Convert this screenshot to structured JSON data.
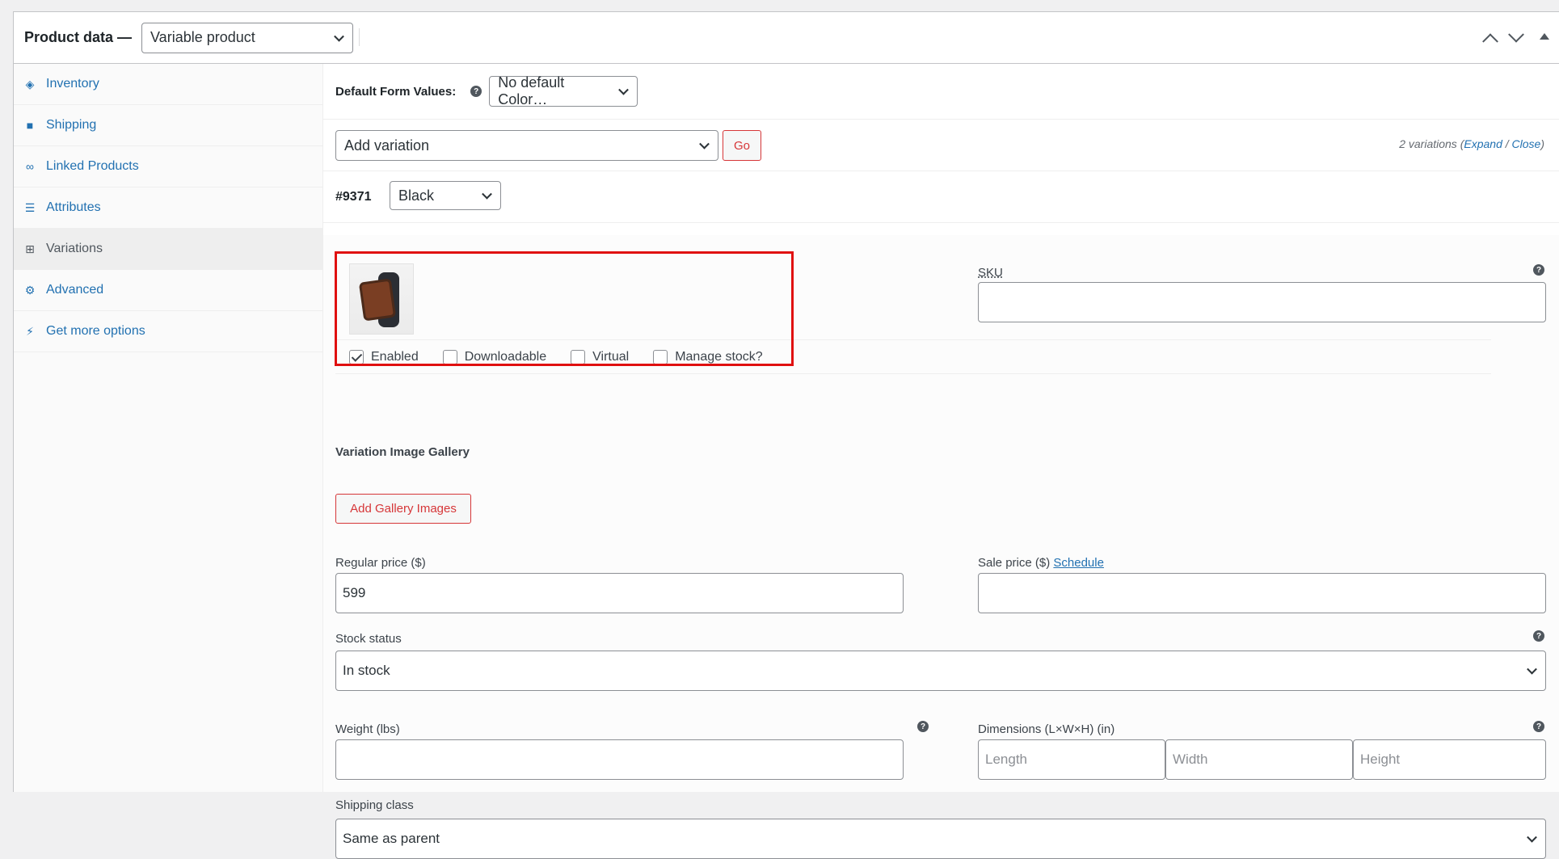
{
  "header": {
    "title": "Product data —",
    "product_type": "Variable product"
  },
  "sidebar": {
    "items": [
      {
        "label": "Inventory",
        "icon": "tag-icon"
      },
      {
        "label": "Shipping",
        "icon": "truck-icon"
      },
      {
        "label": "Linked Products",
        "icon": "link-icon"
      },
      {
        "label": "Attributes",
        "icon": "list-icon"
      },
      {
        "label": "Variations",
        "icon": "grid-icon"
      },
      {
        "label": "Advanced",
        "icon": "gear-icon"
      },
      {
        "label": "Get more options",
        "icon": "plugin-icon"
      }
    ]
  },
  "defaults": {
    "label": "Default Form Values:",
    "color_select": "No default Color…"
  },
  "variation_actions": {
    "select": "Add variation",
    "go": "Go",
    "count_text": "2 variations (",
    "expand": "Expand",
    "slash": " / ",
    "close": "Close",
    "close_paren": ")"
  },
  "variation": {
    "id": "#9371",
    "color": "Black",
    "options": {
      "enabled": "Enabled",
      "downloadable": "Downloadable",
      "virtual": "Virtual",
      "manage_stock": "Manage stock?"
    },
    "enabled_checked": true,
    "sku_label": "SKU",
    "sku_value": "",
    "gallery_label": "Variation Image Gallery",
    "gallery_button": "Add Gallery Images",
    "regular_price_label": "Regular price ($)",
    "regular_price": "599",
    "sale_price_label": "Sale price ($)",
    "schedule": "Schedule",
    "sale_price": "",
    "stock_status_label": "Stock status",
    "stock_status": "In stock",
    "weight_label": "Weight (lbs)",
    "dimensions_label": "Dimensions (L×W×H) (in)",
    "length_ph": "Length",
    "width_ph": "Width",
    "height_ph": "Height",
    "shipping_class_label": "Shipping class",
    "shipping_class": "Same as parent"
  },
  "colors": {
    "link": "#2271b1",
    "accent_red": "#d63638",
    "highlight": "#e01010"
  }
}
